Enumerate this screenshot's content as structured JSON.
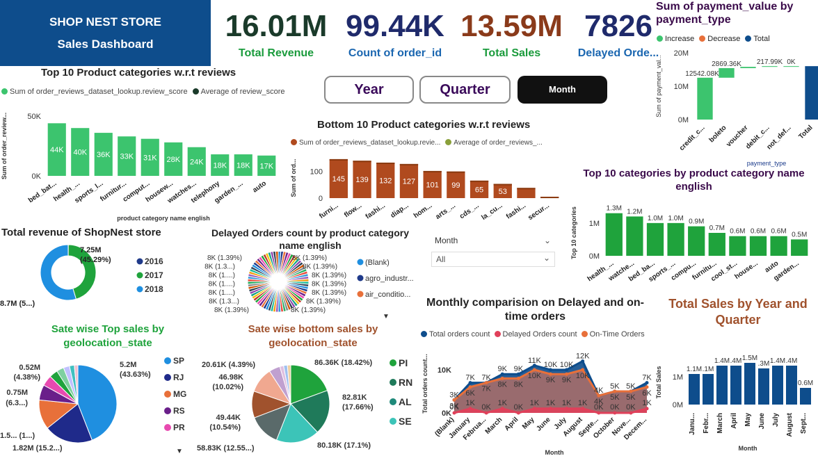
{
  "header": {
    "store": "SHOP NEST STORE",
    "subtitle": "Sales Dashboard",
    "bg": "#0e4d8c"
  },
  "kpis": [
    {
      "value": "16.01M",
      "label": "Total Revenue",
      "value_color": "#1a3a2a",
      "label_color": "#1a9b3c"
    },
    {
      "value": "99.44K",
      "label": "Count of order_id",
      "value_color": "#1f2a6b",
      "label_color": "#1a66b0"
    },
    {
      "value": "13.59M",
      "label": "Total Sales",
      "value_color": "#8a3a1a",
      "label_color": "#1a9b3c"
    },
    {
      "value": "7826",
      "label": "Delayed Orde...",
      "value_color": "#1f2a6b",
      "label_color": "#1a66b0"
    }
  ],
  "buttons": {
    "year": "Year",
    "quarter": "Quarter",
    "month": "Month"
  },
  "slicer": {
    "label": "Month",
    "value": "All"
  },
  "top10": {
    "title": "Top 10 Product categories w.r.t reviews",
    "legend": [
      "Sum of order_reviews_dataset_lookup.review_score",
      "Average of review_score"
    ],
    "ylabel": "Sum of order_review...",
    "xlabel": "product category name english",
    "yticks": [
      "50K",
      "0K"
    ],
    "chart_data": {
      "type": "bar",
      "categories": [
        "bed_bat...",
        "health_...",
        "sports_l...",
        "furnitur...",
        "comput...",
        "housew...",
        "watches...",
        "telephony",
        "garden_...",
        "auto"
      ],
      "values": [
        44,
        40,
        36,
        33,
        31,
        28,
        24,
        18,
        18,
        17
      ],
      "labels": [
        "44K",
        "40K",
        "36K",
        "33K",
        "31K",
        "28K",
        "24K",
        "18K",
        "18K",
        "17K"
      ],
      "color": "#3cc46e"
    }
  },
  "bottom10": {
    "title": "Bottom 10 Product categories w.r.t reviews",
    "legend": [
      "Sum of order_reviews_dataset_lookup.revie...",
      "Average of order_reviews_..."
    ],
    "ylabel": "Sum of ord...",
    "yticks": [
      "100",
      "0"
    ],
    "chart_data": {
      "type": "bar",
      "categories": [
        "furni...",
        "flow...",
        "fashi...",
        "diap...",
        "hom...",
        "arts_...",
        "cds_...",
        "la_cu...",
        "fashi...",
        "secur..."
      ],
      "values": [
        145,
        139,
        132,
        127,
        101,
        99,
        65,
        53,
        38,
        5
      ],
      "labels": [
        "145",
        "139",
        "132",
        "127",
        "101",
        "99",
        "65",
        "53",
        "",
        ""
      ],
      "color": "#b04a1e"
    }
  },
  "waterfall": {
    "title": "Sum of payment_value by payment_type",
    "legend": [
      "Increase",
      "Decrease",
      "Total"
    ],
    "colors": {
      "increase": "#3cc46e",
      "decrease": "#e8703a",
      "total": "#0e4d8c"
    },
    "ylabel": "Sum of payment_val...",
    "xlabel": "payment_type",
    "yticks": [
      "20M",
      "10M",
      "0M"
    ],
    "chart_data": {
      "type": "bar",
      "categories": [
        "credit_c...",
        "boleto",
        "voucher",
        "debit_c...",
        "not_def...",
        "Total"
      ],
      "values": [
        12542.08,
        2869.36,
        379.44,
        217.99,
        0,
        16008.87
      ],
      "labels": [
        "12542.08K",
        "2869.36K",
        "",
        "217.99K",
        "0K",
        ""
      ]
    }
  },
  "top10cat": {
    "title": "Top 10 categories by product category name english",
    "ylabel": "Top 10 categories",
    "yticks": [
      "1M",
      "0M"
    ],
    "chart_data": {
      "type": "bar",
      "categories": [
        "health_...",
        "watche...",
        "bed_ba...",
        "sports_...",
        "compu...",
        "furnitu...",
        "cool_st...",
        "house...",
        "auto",
        "garden..."
      ],
      "values": [
        1.3,
        1.2,
        1.0,
        1.0,
        0.9,
        0.7,
        0.6,
        0.6,
        0.6,
        0.5
      ],
      "labels": [
        "1.3M",
        "1.2M",
        "1.0M",
        "1.0M",
        "0.9M",
        "0.7M",
        "0.6M",
        "0.6M",
        "0.6M",
        "0.5M"
      ],
      "color": "#1fa33c"
    }
  },
  "donut": {
    "title": "Total revenue of ShopNest store",
    "chart_data": {
      "type": "pie",
      "labels": [
        "2016",
        "2017",
        "2018"
      ],
      "values": [
        0.1,
        45.29,
        54.61
      ],
      "colors": [
        "#1f3a8a",
        "#1fa33c",
        "#1f8fe0"
      ]
    },
    "label_2017": "7.25M",
    "label_2017_pct": "(45.29%)",
    "label_2018": "8.7M (5...)"
  },
  "delayed": {
    "title": "Delayed Orders count by product category name english",
    "legend": [
      "(Blank)",
      "agro_industr...",
      "air_conditio..."
    ],
    "legend_colors": [
      "#1f8fe0",
      "#1f3a8a",
      "#e8703a"
    ],
    "labels_left": [
      "8K (1.39%)",
      "8K (1.3...)",
      "8K (1....)",
      "8K (1....)",
      "8K (1....)",
      "8K (1.3...)",
      "8K (1.39%)"
    ],
    "labels_right": [
      "8K (1.39%)",
      "8K (1.39%)",
      "8K (1.39%)",
      "8K (1.39%)",
      "8K (1.39%)",
      "8K (1.39%)",
      "8K (1.39%)"
    ]
  },
  "top_states": {
    "title": "Sate wise Top sales by geolocation_state",
    "chart_data": {
      "type": "pie",
      "labels": [
        "SP",
        "RJ",
        "MG",
        "RS",
        "PR"
      ],
      "values": [
        43.63,
        15.2,
        12.2,
        6.3,
        4.38
      ],
      "colors": [
        "#1f8fe0",
        "#1f2a8a",
        "#e8703a",
        "#6a1f8a",
        "#e84ab0"
      ]
    },
    "slice_labels": [
      "5.2M",
      "(43.63%)",
      "0.52M",
      "(4.38%)",
      "0.75M",
      "(6.3...)",
      "1.5... (1...)",
      "1.82M (15.2...)"
    ],
    "title_color": "#1fa33c"
  },
  "bottom_states": {
    "title": "Sate wise bottom sales by geolocation_state",
    "chart_data": {
      "type": "pie",
      "labels": [
        "PI",
        "RN",
        "AL",
        "SE"
      ],
      "values": [
        18.42,
        17.66,
        17.1,
        12.55,
        10.54,
        10.02,
        4.39
      ],
      "colors": [
        "#1fa33c",
        "#1f7a5a",
        "#3cc4b8",
        "#5a6a6a",
        "#a0522d",
        "#f0a890",
        "#c0a0d0"
      ]
    },
    "slice_labels": [
      "86.36K (18.42%)",
      "82.81K",
      "(17.66%)",
      "80.18K (17.1%)",
      "58.83K (12.55...)",
      "49.44K",
      "(10.54%)",
      "46.98K",
      "(10.02%)",
      "20.61K (4.39%)"
    ],
    "legend_colors": [
      "#1fa33c",
      "#1f7a5a",
      "#1f8a7a",
      "#3cc4b8"
    ],
    "title_color": "#a0522d"
  },
  "monthly": {
    "title": "Monthly comparision on Delayed and on-time orders",
    "legend": [
      "Total orders count",
      "Delayed Orders count",
      "On-Time Orders"
    ],
    "legend_colors": [
      "#0e4d8c",
      "#e0405a",
      "#e8703a"
    ],
    "ylabel": "Total orders count...",
    "xlabel": "Month",
    "yticks": [
      "10K",
      "0K"
    ],
    "chart_data": {
      "type": "area",
      "categories": [
        "(Blank)",
        "January",
        "Februa...",
        "March",
        "April",
        "May",
        "June",
        "July",
        "August",
        "Septe...",
        "October",
        "Nove...",
        "Decem..."
      ],
      "series": [
        {
          "name": "Total orders count",
          "values": [
            3,
            7,
            7,
            9,
            9,
            11,
            10,
            10,
            12,
            4,
            5,
            5,
            7
          ]
        },
        {
          "name": "Delayed Orders count",
          "values": [
            0,
            1,
            0,
            1,
            0,
            1,
            1,
            1,
            1,
            0,
            0,
            0,
            1
          ]
        },
        {
          "name": "On-Time Orders",
          "values": [
            3,
            6,
            7,
            8,
            8,
            10,
            9,
            9,
            10,
            4,
            5,
            5,
            6
          ]
        }
      ],
      "top_labels": [
        "3K",
        "7K",
        "7K",
        "9K",
        "9K",
        "11K",
        "10K",
        "10K",
        "12K",
        "4K",
        "5K",
        "5K",
        "7K"
      ],
      "mid_labels": [
        "3K",
        "6K",
        "7K",
        "8K",
        "8K",
        "10K",
        "9K",
        "9K",
        "10K",
        "4K",
        "5K",
        "5K",
        "6K"
      ],
      "low_labels": [
        "0K",
        "1K",
        "0K",
        "1K",
        "0K",
        "1K",
        "1K",
        "1K",
        "1K",
        "0K",
        "0K",
        "0K",
        "1K"
      ]
    }
  },
  "sales_yq": {
    "title": "Total Sales by Year and Quarter",
    "title_color": "#a0522d",
    "ylabel": "Total Sales",
    "xlabel": "Month",
    "yticks": [
      "1M",
      "0M"
    ],
    "chart_data": {
      "type": "bar",
      "categories": [
        "Janu...",
        "Febr...",
        "March",
        "April",
        "May",
        "June",
        "July",
        "August",
        "Sept..."
      ],
      "values": [
        1.1,
        1.1,
        1.4,
        1.4,
        1.5,
        1.3,
        1.4,
        1.4,
        0.6
      ],
      "labels": [
        "1.1M",
        ".1M",
        "1.4M",
        ".4M",
        "1.5M",
        ".3M",
        "1.4M",
        ".4M",
        "0.6M"
      ],
      "color": "#0e4d8c"
    }
  }
}
